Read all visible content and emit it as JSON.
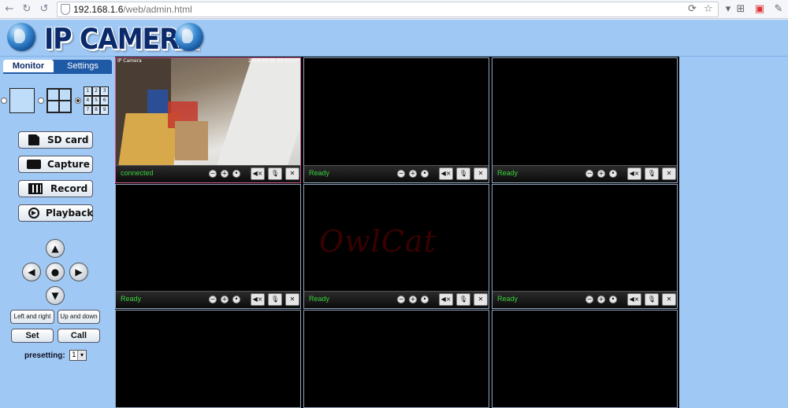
{
  "browser": {
    "url_host": "192.168.1.6",
    "url_path": "/web/admin.html"
  },
  "header": {
    "logo_text": "IP CAMERA"
  },
  "tabs": [
    {
      "label": "Monitor",
      "active": true
    },
    {
      "label": "Settings",
      "active": false
    }
  ],
  "layout_options": {
    "nine_grid_numbers": [
      "1",
      "2",
      "3",
      "4",
      "5",
      "6",
      "7",
      "8",
      "9"
    ],
    "selected": "9"
  },
  "buttons": {
    "sd_card": "SD card",
    "capture": "Capture",
    "record": "Record",
    "playback": "Playback"
  },
  "ptz": {
    "left_right": "Left and right",
    "up_down": "Up and down",
    "set": "Set",
    "call": "Call",
    "presetting_label": "presetting:",
    "presetting_value": "1"
  },
  "cameras": [
    {
      "status": "connected",
      "overlay_name": "IP Camera",
      "overlay_time": "2016-01-01 00:07:07"
    },
    {
      "status": "Ready"
    },
    {
      "status": "Ready"
    },
    {
      "status": "Ready"
    },
    {
      "status": "Ready"
    },
    {
      "status": "Ready"
    }
  ],
  "watermark": "OwlCat",
  "colors": {
    "panel_bg": "#9fc8f4",
    "tab_blue": "#1f5aa6",
    "status_green": "#39d23b",
    "selected_border": "#d35a8a"
  }
}
